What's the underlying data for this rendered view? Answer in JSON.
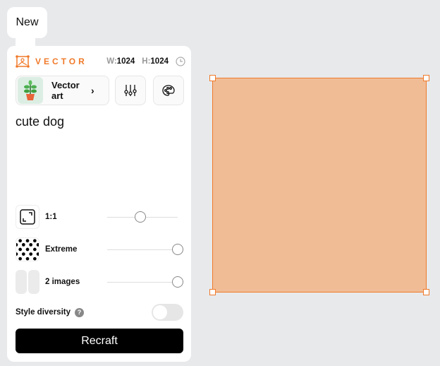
{
  "tab": {
    "label": "New"
  },
  "panel": {
    "mode": "VECTOR",
    "width_label": "W:",
    "width": "1024",
    "height_label": "H:",
    "height": "1024",
    "style": {
      "name": "Vector art"
    },
    "prompt": "cute dog",
    "settings": [
      {
        "label": "1:1",
        "slider_percent": 47
      },
      {
        "label": "Extreme",
        "slider_percent": 100
      },
      {
        "label": "2 images",
        "slider_percent": 100
      }
    ],
    "style_diversity": {
      "label": "Style diversity",
      "enabled": false
    },
    "submit_label": "Recraft"
  },
  "colors": {
    "accent": "#f07a2a",
    "canvas_fill": "#f0bc96"
  }
}
